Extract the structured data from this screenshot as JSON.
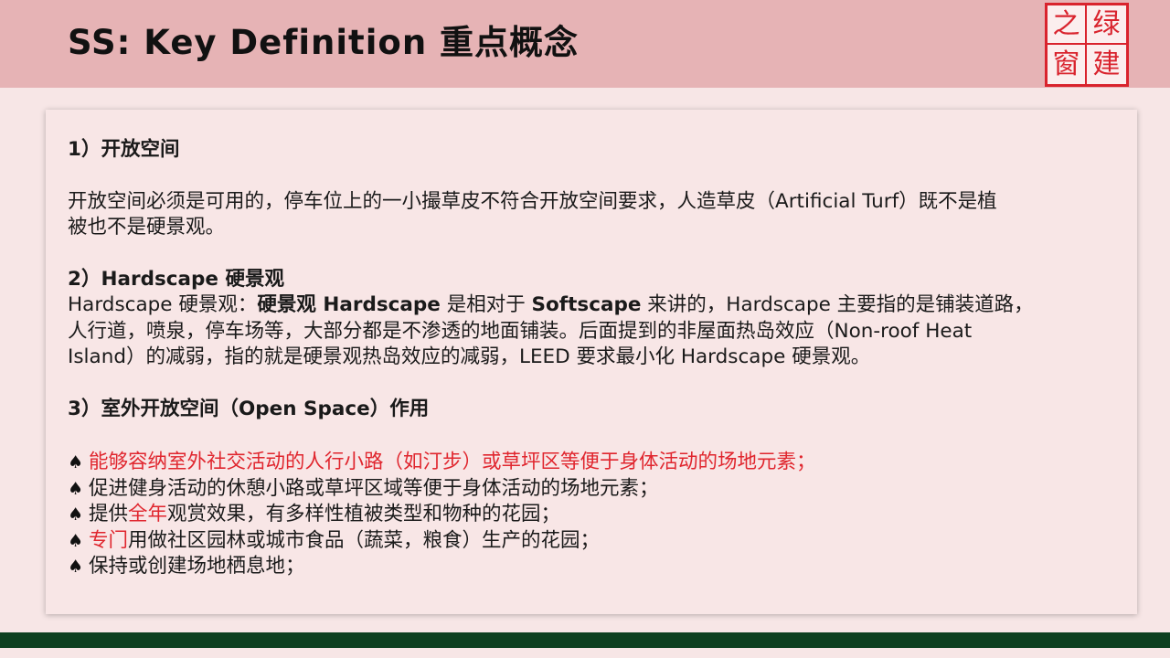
{
  "header": {
    "title": "SS: Key Definition 重点概念",
    "background_color": "#e6b3b5"
  },
  "logo": {
    "top_left": "之",
    "top_right": "绿",
    "bottom_left": "窗",
    "bottom_right": "建",
    "color": "#d9232d"
  },
  "section1": {
    "heading": "1）开放空间",
    "paragraph_line1": "开放空间必须是可用的，停车位上的一小撮草皮不符合开放空间要求，人造草皮（Artificial Turf）既不是植",
    "paragraph_line2": "被也不是硬景观。"
  },
  "section2": {
    "heading": "2）Hardscape 硬景观",
    "prefix": "Hardscape 硬景观：",
    "bold1": "硬景观 Hardscape",
    "mid1": " 是相对于 ",
    "bold2": "Softscape",
    "rest1": " 来讲的，Hardscape 主要指的是铺装道路，",
    "line2": "人行道，喷泉，停车场等，大部分都是不渗透的地面铺装。后面提到的非屋面热岛效应（Non-roof Heat",
    "line3": "Island）的减弱，指的就是硬景观热岛效应的减弱，LEED 要求最小化 Hardscape 硬景观。"
  },
  "section3": {
    "heading": "3）室外开放空间（Open Space）作用",
    "bullet_symbol": "♠",
    "bullet1": "能够容纳室外社交活动的人行小路（如汀步）或草坪区等便于身体活动的场地元素；",
    "bullet2": "促进健身活动的休憩小路或草坪区域等便于身体活动的场地元素；",
    "bullet3_a": "提供",
    "bullet3_red": "全年",
    "bullet3_b": "观赏效果，有多样性植被类型和物种的花园；",
    "bullet4_red": "专门",
    "bullet4_b": "用做社区园林或城市食品（蔬菜，粮食）生产的花园；",
    "bullet5": "保持或创建场地栖息地；"
  },
  "colors": {
    "highlight_red": "#e0262e",
    "footer_green": "#0d4020"
  }
}
